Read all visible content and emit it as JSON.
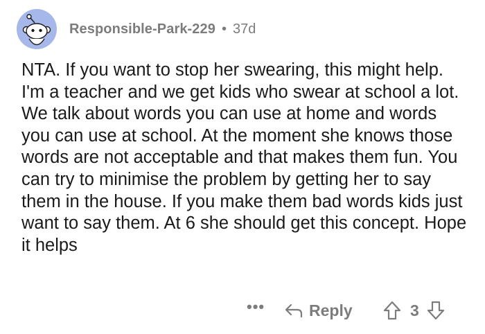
{
  "comment": {
    "author": "Responsible-Park-229",
    "separator": "•",
    "age": "37d",
    "body": "NTA. If you want to stop her swearing, this might help. I'm a teacher and we get kids who swear at school a lot. We talk about words you can use at home and words you can use at school. At the moment she knows those words are not acceptable and that makes them fun. You can try to minimise the problem by getting her to say them in the house. If you make them bad words kids just want to say them. At 6 she should get this concept. Hope it helps",
    "avatar_icon": "snoo-avatar-icon",
    "avatar_color": "#a6b7e9"
  },
  "actions": {
    "more_label": "•••",
    "more_icon": "more-options-icon",
    "reply_icon": "reply-arrow-icon",
    "reply_label": "Reply",
    "upvote_icon": "upvote-arrow-icon",
    "score": "3",
    "downvote_icon": "downvote-arrow-icon"
  },
  "colors": {
    "text": "#1a1a1b",
    "meta": "#7c7c7c",
    "background": "#ffffff"
  }
}
